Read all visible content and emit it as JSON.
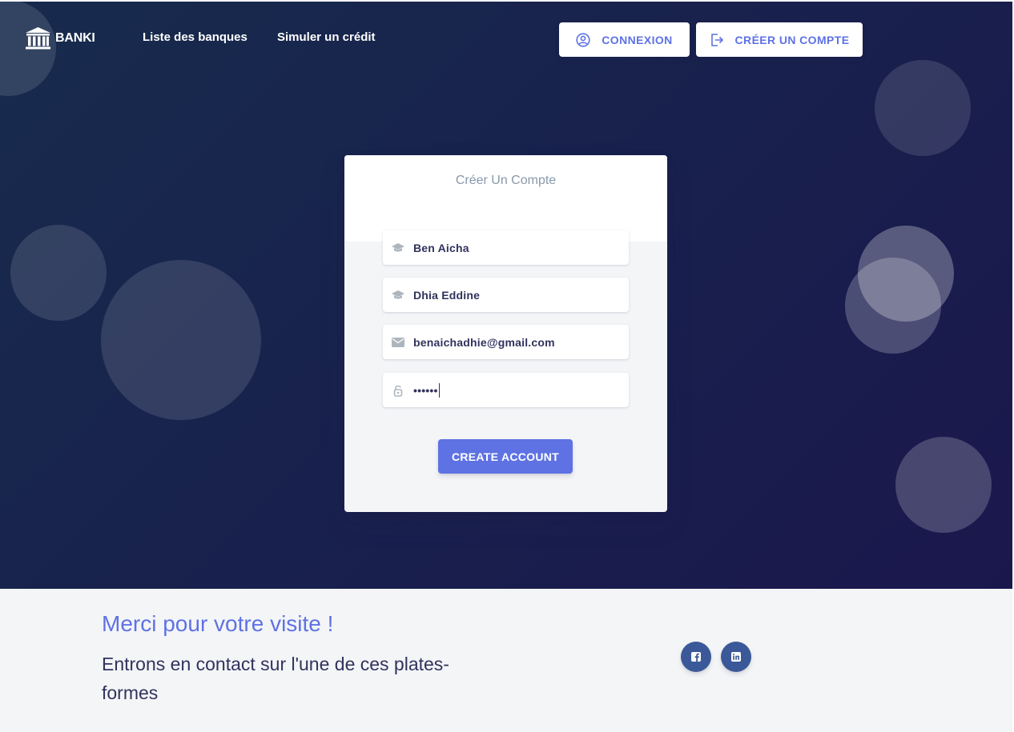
{
  "brand": {
    "name": "BANKI"
  },
  "nav": {
    "links": [
      "Liste des banques",
      "Simuler un crédit"
    ],
    "login_label": "CONNEXION",
    "register_label": "CRÉER UN COMPTE"
  },
  "form": {
    "title": "Créer Un Compte",
    "fields": [
      {
        "icon": "hat-icon",
        "value": "Ben Aicha"
      },
      {
        "icon": "hat-icon",
        "value": "Dhia Eddine"
      },
      {
        "icon": "email-icon",
        "value": "benaichadhie@gmail.com"
      },
      {
        "icon": "lock-icon",
        "value": "••••••"
      }
    ],
    "submit_label": "CREATE ACCOUNT"
  },
  "footer": {
    "title": "Merci pour votre visite !",
    "subtitle": "Entrons en contact sur l'une de ces plates-formes",
    "social": [
      {
        "icon": "facebook-icon",
        "color": "#3b5998"
      },
      {
        "icon": "linkedin-icon",
        "color": "#3b5998"
      }
    ]
  },
  "colors": {
    "primary": "#5e72e4",
    "hero_start": "#172b4d",
    "hero_end": "#1a174d",
    "footer_bg": "#f4f5f7"
  }
}
